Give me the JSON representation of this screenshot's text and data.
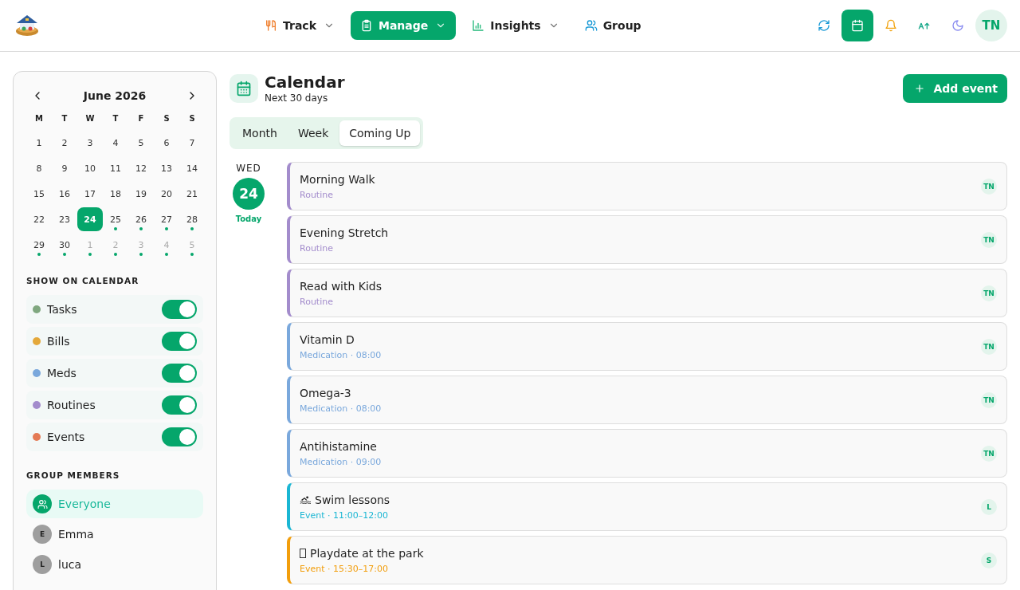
{
  "nav": {
    "items": [
      {
        "label": "Track",
        "selected": false,
        "dropdown": true
      },
      {
        "label": "Manage",
        "selected": true,
        "dropdown": true
      },
      {
        "label": "Insights",
        "selected": false,
        "dropdown": true
      },
      {
        "label": "Group",
        "selected": false,
        "dropdown": false
      }
    ],
    "actions": [
      {
        "selected": false
      },
      {
        "selected": true
      },
      {
        "selected": false
      },
      {
        "selected": false
      },
      {
        "selected": false
      }
    ],
    "avatar": "TN"
  },
  "mini_calendar": {
    "month": "June 2026",
    "weekdays": [
      "M",
      "T",
      "W",
      "T",
      "F",
      "S",
      "S"
    ],
    "days": [
      {
        "label": "1",
        "muted": false,
        "selected": false,
        "dot": false
      },
      {
        "label": "2",
        "muted": false,
        "selected": false,
        "dot": false
      },
      {
        "label": "3",
        "muted": false,
        "selected": false,
        "dot": false
      },
      {
        "label": "4",
        "muted": false,
        "selected": false,
        "dot": false
      },
      {
        "label": "5",
        "muted": false,
        "selected": false,
        "dot": false
      },
      {
        "label": "6",
        "muted": false,
        "selected": false,
        "dot": false
      },
      {
        "label": "7",
        "muted": false,
        "selected": false,
        "dot": false
      },
      {
        "label": "8",
        "muted": false,
        "selected": false,
        "dot": false
      },
      {
        "label": "9",
        "muted": false,
        "selected": false,
        "dot": false
      },
      {
        "label": "10",
        "muted": false,
        "selected": false,
        "dot": false
      },
      {
        "label": "11",
        "muted": false,
        "selected": false,
        "dot": false
      },
      {
        "label": "12",
        "muted": false,
        "selected": false,
        "dot": false
      },
      {
        "label": "13",
        "muted": false,
        "selected": false,
        "dot": false
      },
      {
        "label": "14",
        "muted": false,
        "selected": false,
        "dot": false
      },
      {
        "label": "15",
        "muted": false,
        "selected": false,
        "dot": false
      },
      {
        "label": "16",
        "muted": false,
        "selected": false,
        "dot": false
      },
      {
        "label": "17",
        "muted": false,
        "selected": false,
        "dot": false
      },
      {
        "label": "18",
        "muted": false,
        "selected": false,
        "dot": false
      },
      {
        "label": "19",
        "muted": false,
        "selected": false,
        "dot": false
      },
      {
        "label": "20",
        "muted": false,
        "selected": false,
        "dot": false
      },
      {
        "label": "21",
        "muted": false,
        "selected": false,
        "dot": false
      },
      {
        "label": "22",
        "muted": false,
        "selected": false,
        "dot": false
      },
      {
        "label": "23",
        "muted": false,
        "selected": false,
        "dot": false
      },
      {
        "label": "24",
        "muted": false,
        "selected": true,
        "dot": false
      },
      {
        "label": "25",
        "muted": false,
        "selected": false,
        "dot": true
      },
      {
        "label": "26",
        "muted": false,
        "selected": false,
        "dot": true
      },
      {
        "label": "27",
        "muted": false,
        "selected": false,
        "dot": true
      },
      {
        "label": "28",
        "muted": false,
        "selected": false,
        "dot": true
      },
      {
        "label": "29",
        "muted": false,
        "selected": false,
        "dot": true
      },
      {
        "label": "30",
        "muted": false,
        "selected": false,
        "dot": true
      },
      {
        "label": "1",
        "muted": true,
        "selected": false,
        "dot": true
      },
      {
        "label": "2",
        "muted": true,
        "selected": false,
        "dot": true
      },
      {
        "label": "3",
        "muted": true,
        "selected": false,
        "dot": true
      },
      {
        "label": "4",
        "muted": true,
        "selected": false,
        "dot": true
      },
      {
        "label": "5",
        "muted": true,
        "selected": false,
        "dot": true
      }
    ]
  },
  "show_on_calendar": {
    "title": "SHOW ON CALENDAR",
    "items": [
      {
        "label": "Tasks",
        "color": "#7fa77f",
        "on": true
      },
      {
        "label": "Bills",
        "color": "#e4a83a",
        "on": true
      },
      {
        "label": "Meds",
        "color": "#7aa8dc",
        "on": true
      },
      {
        "label": "Routines",
        "color": "#a38ccc",
        "on": true
      },
      {
        "label": "Events",
        "color": "#e47a55",
        "on": true
      }
    ]
  },
  "group_members": {
    "title": "GROUP MEMBERS",
    "items": [
      {
        "label": "Everyone",
        "kind": "group",
        "selected": true
      },
      {
        "label": "Emma",
        "kind": "person",
        "initial": "E",
        "selected": false
      },
      {
        "label": "luca",
        "kind": "person",
        "initial": "L",
        "selected": false
      }
    ]
  },
  "header": {
    "title": "Calendar",
    "subtitle": "Next 30 days",
    "add_button": "Add event"
  },
  "tabs": [
    {
      "label": "Month",
      "selected": false
    },
    {
      "label": "Week",
      "selected": false
    },
    {
      "label": "Coming Up",
      "selected": true
    }
  ],
  "agenda": [
    {
      "weekday": "WED",
      "day": "24",
      "today_label": "Today",
      "events": [
        {
          "title": "Morning Walk",
          "meta": "Routine",
          "color": "#a38ccc",
          "kind": "plain",
          "owner": "TN"
        },
        {
          "title": "Evening Stretch",
          "meta": "Routine",
          "color": "#a38ccc",
          "kind": "plain",
          "owner": "TN"
        },
        {
          "title": "Read with Kids",
          "meta": "Routine",
          "color": "#a38ccc",
          "kind": "plain",
          "owner": "TN"
        },
        {
          "title": "Vitamin D",
          "meta": "Medication · 08:00",
          "color": "#7aa8dc",
          "kind": "plain",
          "owner": "TN"
        },
        {
          "title": "Omega-3",
          "meta": "Medication · 08:00",
          "color": "#7aa8dc",
          "kind": "plain",
          "owner": "TN"
        },
        {
          "title": "Antihistamine",
          "meta": "Medication · 09:00",
          "color": "#7aa8dc",
          "kind": "plain",
          "owner": "TN"
        },
        {
          "title": "Swim lessons",
          "meta": "Event · 11:00–12:00",
          "color": "#1ab6d3",
          "kind": "swim",
          "owner": "L"
        },
        {
          "title": "Playdate at the park",
          "meta": "Event · 15:30–17:00",
          "color": "#f29e0c",
          "kind": "unknown",
          "owner": "S"
        }
      ]
    }
  ]
}
